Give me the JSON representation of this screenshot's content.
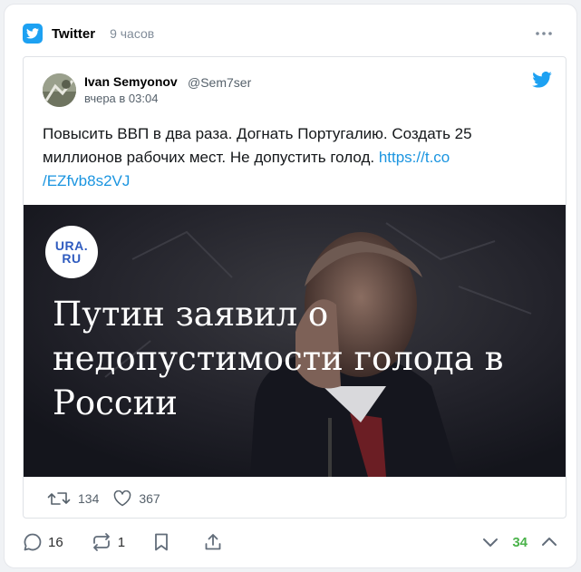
{
  "source": {
    "name": "Twitter",
    "time": "9 часов",
    "icon": "twitter-bird-icon"
  },
  "tweet": {
    "author_name": "Ivan Semyonov",
    "author_handle": "@Sem7ser",
    "time": "вчера в 03:04",
    "text": "Повысить ВВП в два раза. Догнать Португалию. Создать 25 миллионов рабочих мест. Не допустить голод. ",
    "link_line1": "https://t.co",
    "link_line2": "/EZfvb8s2VJ",
    "media": {
      "logo_line1": "URA.",
      "logo_line2": "RU",
      "headline": "Путин заявил о недопустимости голода в России"
    },
    "retweets": "134",
    "likes": "367"
  },
  "footer": {
    "comments": "16",
    "reposts": "1",
    "score": "34"
  },
  "colors": {
    "twitter_blue": "#1da1f2",
    "link": "#1b95e0",
    "score_green": "#4bb34b"
  }
}
